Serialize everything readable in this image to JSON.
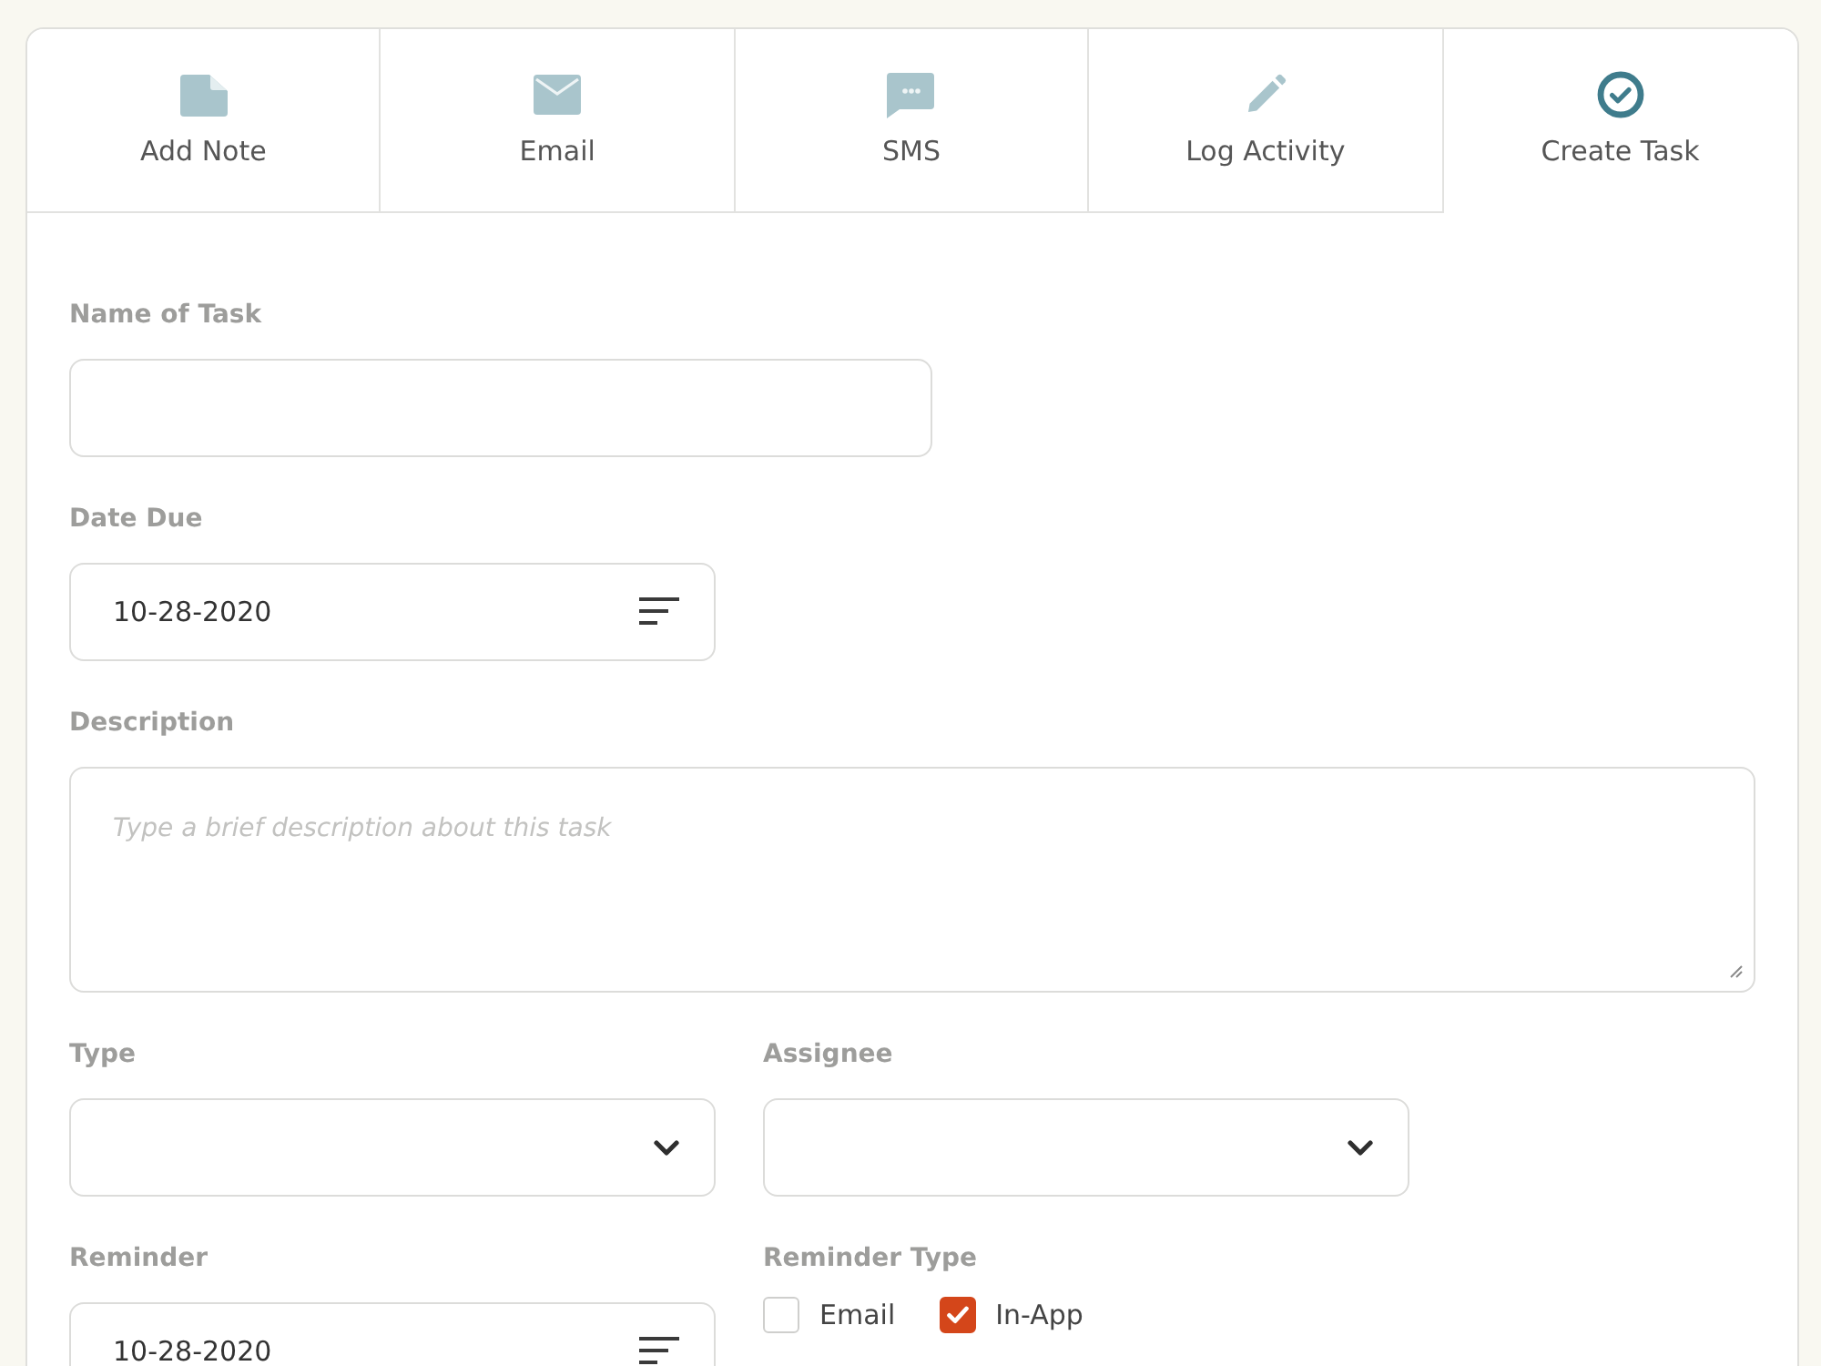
{
  "tabs": [
    {
      "label": "Add Note",
      "selected": false
    },
    {
      "label": "Email",
      "selected": false
    },
    {
      "label": "SMS",
      "selected": false
    },
    {
      "label": "Log Activity",
      "selected": false
    },
    {
      "label": "Create Task",
      "selected": true
    }
  ],
  "form": {
    "rows": [
      {
        "fields": [
          {
            "kind": "text",
            "label": "Name of Task"
          }
        ]
      },
      {
        "fields": [
          {
            "kind": "date",
            "label": "Date Due",
            "value": "10-28-2020"
          }
        ]
      },
      {
        "fields": [
          {
            "kind": "textarea",
            "label": "Description",
            "placeholder": "Type a brief description about this task"
          }
        ]
      },
      {
        "fields": [
          {
            "kind": "select",
            "label": "Type"
          },
          {
            "kind": "select",
            "label": "Assignee"
          }
        ]
      },
      {
        "fields": [
          {
            "kind": "date",
            "label": "Reminder",
            "value": "10-28-2020"
          },
          {
            "kind": "checkboxes",
            "label": "Reminder Type",
            "options": [
              {
                "label": "Email",
                "checked": false
              },
              {
                "label": "In-App",
                "checked": true
              }
            ]
          }
        ]
      }
    ]
  }
}
